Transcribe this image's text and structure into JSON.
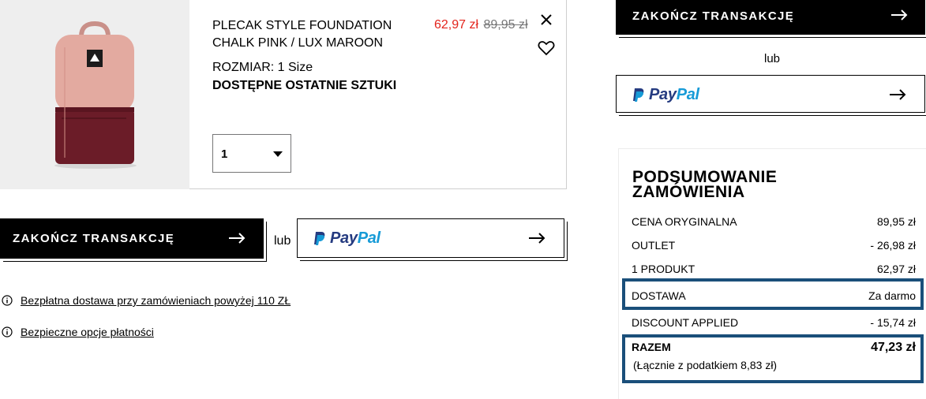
{
  "product": {
    "name_line1": "PLECAK STYLE FOUNDATION",
    "name_line2": "CHALK PINK / LUX MAROON",
    "sale_price": "62,97 zł",
    "original_price": "89,95 zł",
    "size": "ROZMIAR: 1 Size",
    "stock_status": "DOSTĘPNE OSTATNIE SZTUKI",
    "quantity": "1",
    "colors": {
      "bag_top": "#e3aaa0",
      "bag_bottom": "#6b1c28",
      "sale": "#e3231b"
    }
  },
  "checkout": {
    "checkout_label": "ZAKOŃCZ TRANSAKCJĘ",
    "or_label": "lub",
    "paypal_pay": "Pay",
    "paypal_pal": "Pal"
  },
  "info": {
    "free_delivery": "Bezpłatna dostawa przy zamówieniach powyżej 110 ZŁ",
    "secure_payment": "Bezpieczne opcje płatności"
  },
  "summary": {
    "title": "PODSUMOWANIE ZAMÓWIENIA",
    "rows": [
      {
        "label": "CENA ORYGINALNA",
        "value": "89,95 zł"
      },
      {
        "label": "OUTLET",
        "value": "- 26,98 zł"
      },
      {
        "label": "1 PRODUKT",
        "value": "62,97 zł"
      },
      {
        "label": "DOSTAWA",
        "value": "Za darmo"
      },
      {
        "label": "DISCOUNT APPLIED",
        "value": "- 15,74 zł"
      }
    ],
    "total_label": "RAZEM",
    "total_value": "47,23 zł",
    "tax_note": "(Łącznie z podatkiem  8,83 zł)",
    "highlight_color": "#1a4f7a"
  }
}
